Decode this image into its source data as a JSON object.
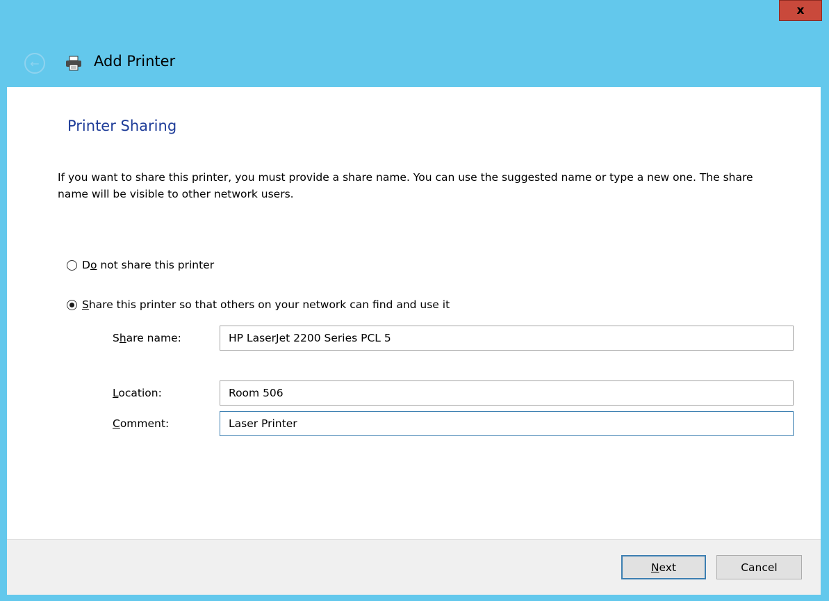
{
  "window": {
    "title": "Add Printer",
    "close_label": "x"
  },
  "page": {
    "heading": "Printer Sharing",
    "description": "If you want to share this printer, you must provide a share name. You can use the suggested name or type a new one. The share name will be visible to other network users."
  },
  "options": {
    "no_share": {
      "prefix": "D",
      "mnemonic": "o",
      "rest": " not share this printer",
      "selected": false
    },
    "share": {
      "prefix": "",
      "mnemonic": "S",
      "rest": "hare this printer so that others on your network can find and use it",
      "selected": true
    }
  },
  "fields": {
    "share_name": {
      "label_prefix": "S",
      "label_mnemonic": "h",
      "label_rest": "are name:",
      "value": "HP LaserJet 2200 Series PCL 5"
    },
    "location": {
      "label_prefix": "",
      "label_mnemonic": "L",
      "label_rest": "ocation:",
      "value": "Room 506"
    },
    "comment": {
      "label_prefix": "",
      "label_mnemonic": "C",
      "label_rest": "omment:",
      "value": "Laser Printer"
    }
  },
  "buttons": {
    "next": {
      "mnemonic": "N",
      "rest": "ext"
    },
    "cancel": {
      "label": "Cancel"
    }
  },
  "colors": {
    "frame": "#63c8ec",
    "heading": "#1f3d99",
    "close": "#c9493b",
    "focus": "#3c7fb1"
  },
  "icons": {
    "back": "back-arrow-icon",
    "printer": "printer-icon",
    "close": "close-icon"
  }
}
